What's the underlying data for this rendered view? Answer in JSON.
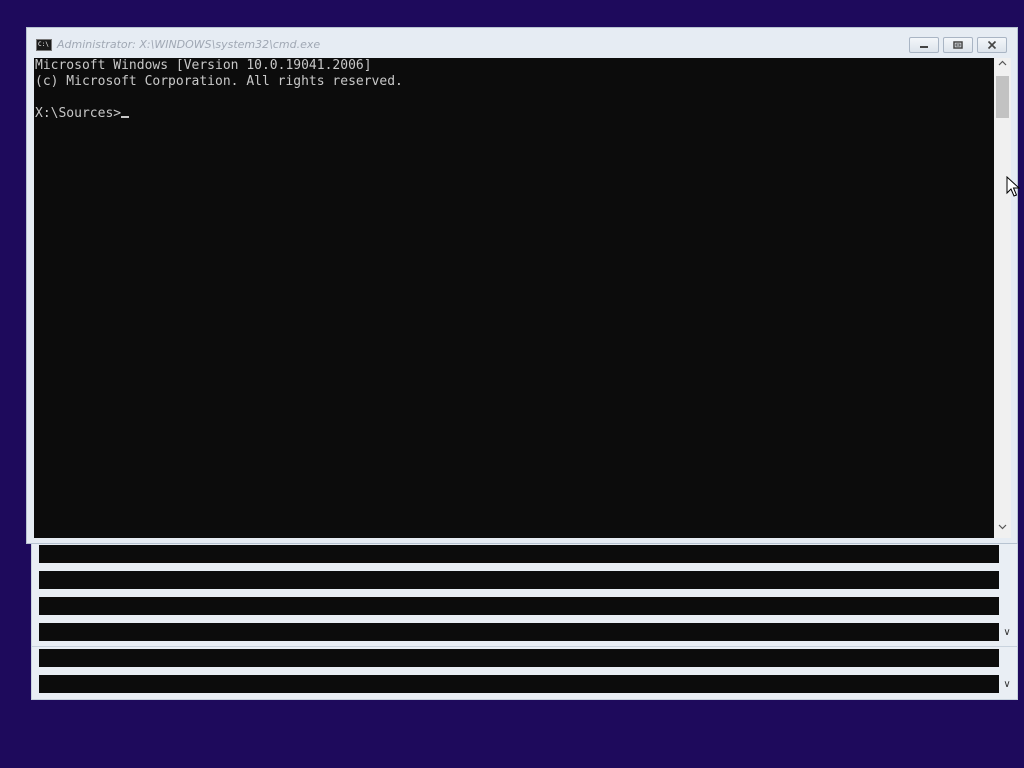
{
  "window": {
    "title": "Administrator: X:\\WINDOWS\\system32\\cmd.exe",
    "icon_text": "C:\\"
  },
  "caption_buttons": {
    "minimize_icon": "minimize-icon",
    "maximize_icon": "restore-icon",
    "close_icon": "close-icon"
  },
  "console": {
    "lines": [
      "Microsoft Windows [Version 10.0.19041.2006]",
      "(c) Microsoft Corporation. All rights reserved.",
      "",
      "X:\\Sources>"
    ]
  },
  "scrollbar": {
    "up_icon": "chevron-up-icon",
    "down_icon": "chevron-down-icon"
  },
  "colors": {
    "desktop": "#1e0a5c",
    "console_bg": "#0c0c0c",
    "console_fg": "#c8c8c8",
    "window_frame": "#e6ecf3"
  }
}
